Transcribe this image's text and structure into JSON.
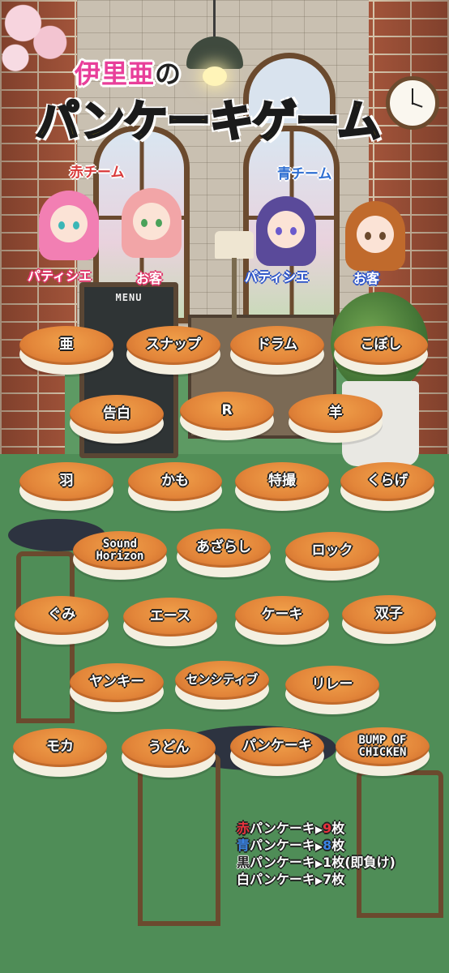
{
  "title": {
    "line1": "伊里亜",
    "line1_suffix": "の",
    "line2": "パンケーキゲーム"
  },
  "teams": {
    "red": {
      "label": "赤チーム",
      "color": "#d93a3a",
      "patissier_role": "パティシエ",
      "customer_role": "お客"
    },
    "blue": {
      "label": "青チーム",
      "color": "#2f6fd2",
      "patissier_role": "パティシエ",
      "customer_role": "お客"
    }
  },
  "scenery": {
    "menu_board": "MENU"
  },
  "pancakes": [
    "亜",
    "スナップ",
    "ドラム",
    "こぼし",
    "告白",
    "R",
    "羊",
    "羽",
    "かも",
    "特撮",
    "くらげ",
    "Sound\nHorizon",
    "あざらし",
    "ロック",
    "ぐみ",
    "エース",
    "ケーキ",
    "双子",
    "ヤンキー",
    "センシティブ",
    "リレー",
    "モカ",
    "うどん",
    "パンケーキ",
    "BUMP OF\nCHICKEN"
  ],
  "legend": [
    {
      "color_word": "赤",
      "color": "#e8323c",
      "item": "パンケーキ",
      "arrow": "▶",
      "count": "9",
      "count_color": "#e8323c",
      "unit": "枚",
      "note": ""
    },
    {
      "color_word": "青",
      "color": "#3a84e6",
      "item": "パンケーキ",
      "arrow": "▶",
      "count": "8",
      "count_color": "#3a84e6",
      "unit": "枚",
      "note": ""
    },
    {
      "color_word": "黒",
      "color": "#222222",
      "item": "パンケーキ",
      "arrow": "▶",
      "count": "1",
      "count_color": "#ffffff",
      "unit": "枚",
      "note": "(即負け)"
    },
    {
      "color_word": "白",
      "color": "#ffffff",
      "item": "パンケーキ",
      "arrow": "▶",
      "count": "7",
      "count_color": "#ffffff",
      "unit": "枚",
      "note": ""
    }
  ],
  "icons": [
    "clock-icon",
    "hanging-lamp-icon",
    "menu-board-icon"
  ]
}
